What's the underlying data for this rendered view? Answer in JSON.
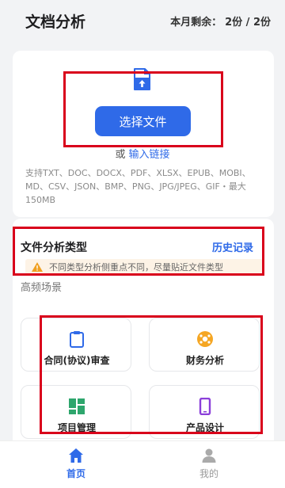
{
  "header": {
    "title": "文档分析",
    "quota_label": "本月剩余：",
    "quota_value": "2份 / 2份"
  },
  "upload": {
    "select_button": "选择文件",
    "or_text": "或",
    "link_text": "输入链接",
    "support_text": "支持TXT、DOC、DOCX、PDF、XLSX、EPUB、MOBI、MD、CSV、JSON、BMP、PNG、JPG/JPEG、GIF・最大150MB"
  },
  "analysis": {
    "title": "文件分析类型",
    "history_link": "历史记录",
    "notice": "不同类型分析侧重点不同，尽量贴近文件类型",
    "freq_label": "高频场景",
    "tiles": [
      {
        "label": "合同(协议)审查",
        "icon": "clipboard-icon"
      },
      {
        "label": "财务分析",
        "icon": "finance-icon"
      },
      {
        "label": "项目管理",
        "icon": "grid-icon"
      },
      {
        "label": "产品设计",
        "icon": "phone-icon"
      }
    ]
  },
  "tabbar": {
    "home": "首页",
    "mine": "我的"
  },
  "colors": {
    "accent": "#2f6ae8",
    "highlight_border": "#d9001b",
    "warning": "#f0a020"
  }
}
